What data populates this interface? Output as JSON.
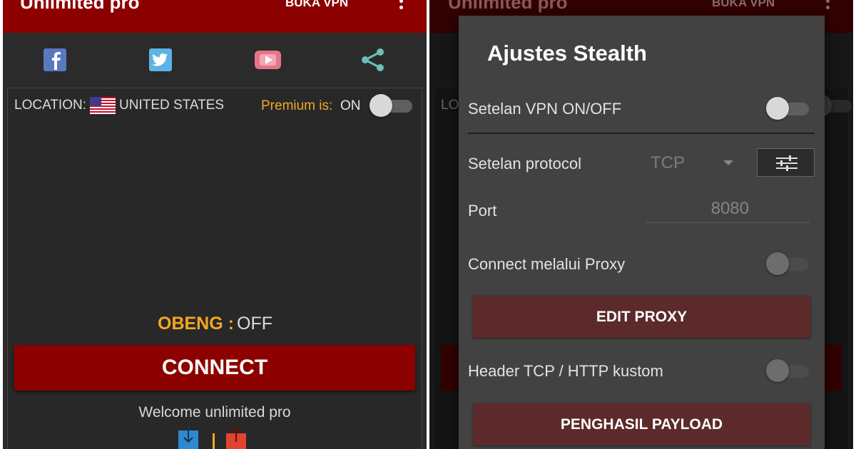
{
  "app": {
    "title": "Unlimited pro",
    "open_vpn_label": "BUKA VPN"
  },
  "social": [
    "facebook-icon",
    "twitter-icon",
    "youtube-icon",
    "share-icon"
  ],
  "location": {
    "label": "LOCATION:",
    "country": "UNITED STATES",
    "flag": "us-flag-icon"
  },
  "premium": {
    "label": "Premium is:",
    "value": "ON",
    "toggle_on": false
  },
  "obeng": {
    "label": "OBENG :",
    "value": "OFF"
  },
  "connect_label": "CONNECT",
  "welcome": "Welcome unlimited pro",
  "traffic_icons": [
    "download-icon",
    "upload-icon"
  ],
  "background_peek": {
    "location_fragment": "LO"
  },
  "dialog": {
    "title": "Ajustes Stealth",
    "vpn_toggle_label": "Setelan VPN ON/OFF",
    "protocol_label": "Setelan protocol",
    "protocol_value": "TCP",
    "port_label": "Port",
    "port_value": "8080",
    "proxy_label": "Connect melalui Proxy",
    "edit_proxy_label": "EDIT PROXY",
    "header_label": "Header TCP / HTTP kustom",
    "payload_label": "PENGHASIL PAYLOAD"
  },
  "colors": {
    "brand_red": "#8d0000",
    "accent_orange": "#f5a623",
    "dialog_button": "#5c2a2a"
  }
}
